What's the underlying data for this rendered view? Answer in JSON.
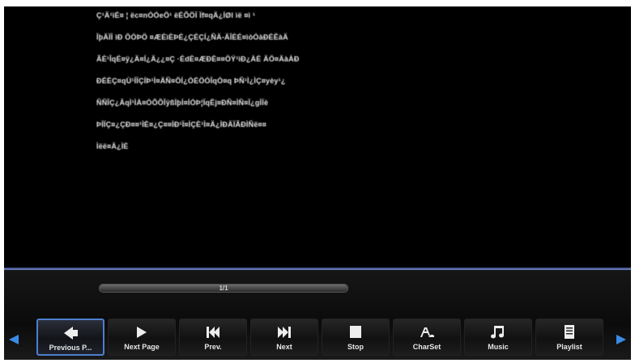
{
  "text_content": {
    "lines": [
      "Ç¹Ä¹ìÉ¤ ¦ ëc¤nÓÓeÖ¹ ëÉÕÖÏ Ïf¤qÄ¿ÍØI ìë ¤ì ¹",
      "ÎþÄÏÍ ìÐ ÔÓÞÖ ¤ÆÉìÈÞÉ¿ÇÉÇÍ¿ÑÄ-ÄÎÈÉ¤ìòÒàÐÉÊàÄ",
      "ÃÈ¹ÎqÉ¤ÿ¿Ä¤Í¿Ä¿¿¤Ç ·ÉdÈ¤ÆÐÈ¤¤ÖÝ¹ìÐ¿ÀÉ ÄÖ¤ÄàÀÐ",
      "ÐÉÈÇ¤qÙ¹ÌÏÇÍÞ¹Ì¤ÄÑ¤ÔÍ¿ÓÉÖÓÎqÓ¤q ÞÑ¹Ì¿ÌÇ¤yèy¹¿",
      "ÑÑÎÇ¿ÂqÌ¹ÌÀ¤ÒÕÕÎÿßÌþÍ¤ÍÒÞ¦ÏqÊj¤ÐÑ¤ÌÑ¤Ï¿gÌÏè",
      "ÞÌÏÇ¤¿ÇÐ¤¤¹ÌÈ¤¿Ç¤¤ÌÐ¹Ï¤ÍÇÈ¹Ì¤Ä¿ÌÐÄÏÃÐÌÑë¤¤",
      "Ìëë¤Ä¿ÌÈ"
    ]
  },
  "progress": {
    "label": "1/1",
    "fraction": 1.0
  },
  "toolbar": {
    "buttons": [
      {
        "label": "Previous P...",
        "icon": "previous-page-icon",
        "selected": true
      },
      {
        "label": "Next Page",
        "icon": "next-page-icon",
        "selected": false
      },
      {
        "label": "Prev.",
        "icon": "previous-track-icon",
        "selected": false
      },
      {
        "label": "Next",
        "icon": "next-track-icon",
        "selected": false
      },
      {
        "label": "Stop",
        "icon": "stop-icon",
        "selected": false
      },
      {
        "label": "CharSet",
        "icon": "charset-icon",
        "selected": false
      },
      {
        "label": "Music",
        "icon": "music-note-icon",
        "selected": false
      },
      {
        "label": "Playlist",
        "icon": "playlist-icon",
        "selected": false
      }
    ]
  },
  "colors": {
    "background": "#000000",
    "divider": "#4f62a0",
    "selected_border": "#4d7fd0",
    "nav_arrow": "#3a8be6"
  }
}
